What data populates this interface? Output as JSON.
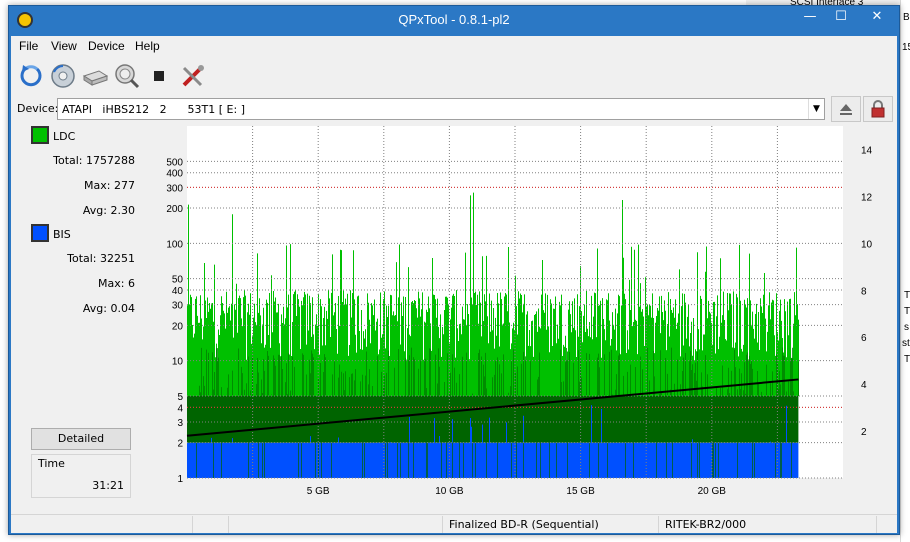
{
  "window": {
    "title": "QPxTool - 0.8.1-pl2",
    "min": "—",
    "max": "☐",
    "close": "✕"
  },
  "menu": [
    "File",
    "View",
    "Device",
    "Help"
  ],
  "toolbar": [
    "refresh-icon",
    "disc-info-icon",
    "drive-icon",
    "scan-icon",
    "stop-icon",
    "settings-tools-icon"
  ],
  "device": {
    "label": "Device:",
    "value": "ATAPI   iHBS212   2      53T1 [ E: ]"
  },
  "legend": {
    "ldc": {
      "name": "LDC",
      "color": "#00c000",
      "total": "Total: 1757288",
      "max": "Max: 277",
      "avg": "Avg: 2.30"
    },
    "bis": {
      "name": "BIS",
      "color": "#0050ff",
      "total": "Total: 32251",
      "max": "Max: 6",
      "avg": "Avg: 0.04"
    }
  },
  "detailed_button": "Detailed",
  "time": {
    "label": "Time",
    "value": "31:21"
  },
  "status": [
    "",
    "",
    "",
    "Finalized BD-R (Sequential)",
    "RITEK-BR2/000",
    ""
  ],
  "background": {
    "top_right": "SCSI Interface 3",
    "edge": [
      "B",
      "15",
      "T",
      "T",
      "s",
      "st",
      "T"
    ]
  },
  "chart_data": {
    "type": "bar",
    "x_ticks": [
      "5 GB",
      "10 GB",
      "15 GB",
      "20 GB"
    ],
    "x_tick_values": [
      5,
      10,
      15,
      20
    ],
    "xlim": [
      0,
      25
    ],
    "y_left_scale": "log",
    "y_left_ticks": [
      "1",
      "2",
      "3",
      "4",
      "5",
      "10",
      "20",
      "30",
      "40",
      "50",
      "100",
      "200",
      "300",
      "400",
      "500"
    ],
    "ylim_left": [
      1,
      1000
    ],
    "y_right_ticks": [
      "2",
      "4",
      "6",
      "8",
      "10",
      "12",
      "14"
    ],
    "ylim_right": [
      0,
      15
    ],
    "data_end_gb": 23.3,
    "grid": true,
    "series": [
      {
        "name": "LDC",
        "color": "#00c000",
        "typical": [
          10,
          40
        ],
        "peak": 277
      },
      {
        "name": "BIS",
        "color": "#0050ff",
        "typical": [
          0,
          2
        ],
        "peak": 6
      },
      {
        "name": "speed",
        "color": "#000000",
        "start": 1.8,
        "end": 4.2
      }
    ]
  }
}
